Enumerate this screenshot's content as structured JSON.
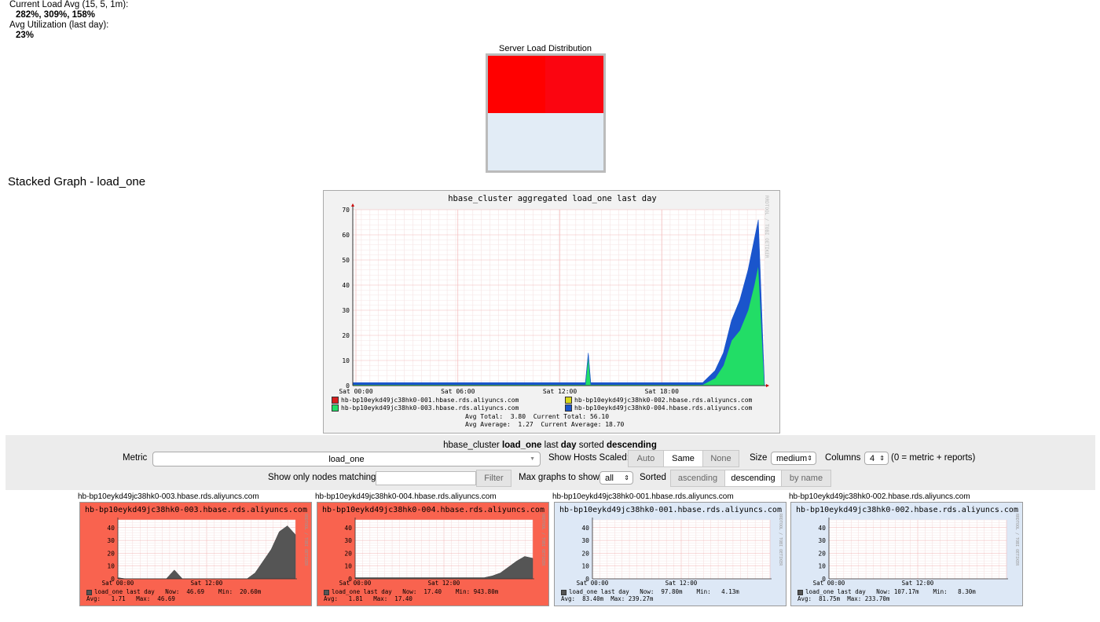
{
  "summary": {
    "load_avg_label": "Current Load Avg (15, 5, 1m):",
    "load_avg_value": "282%, 309%, 158%",
    "util_label": "Avg Utilization (last day):",
    "util_value": "23%"
  },
  "heatmap": {
    "title": "Server Load Distribution",
    "cells": [
      {
        "color": "#ff0000"
      },
      {
        "color": "#fb0510"
      },
      {
        "color": "#e2ecf6"
      },
      {
        "color": "#e2ecf6"
      }
    ]
  },
  "stacked": {
    "section_title": "Stacked Graph - load_one",
    "graph_title": "hbase_cluster aggregated load_one last day",
    "side_label": "RRDTOOL / TOBI OETIKER",
    "legend": [
      {
        "name": "hb-bp10eykd49jc38hk0-001.hbase.rds.aliyuncs.com",
        "color": "#d81e1e"
      },
      {
        "name": "hb-bp10eykd49jc38hk0-002.hbase.rds.aliyuncs.com",
        "color": "#d9d91a"
      },
      {
        "name": "hb-bp10eykd49jc38hk0-003.hbase.rds.aliyuncs.com",
        "color": "#22dd66"
      },
      {
        "name": "hb-bp10eykd49jc38hk0-004.hbase.rds.aliyuncs.com",
        "color": "#1a55cc"
      }
    ],
    "stats_line1": "Avg Total:  3.80  Current Total: 56.10",
    "stats_line2": "Avg Average:  1.27  Current Average: 18.70"
  },
  "chart_data": {
    "type": "area",
    "title": "hbase_cluster aggregated load_one last day",
    "ylim": [
      0,
      70
    ],
    "yticks": [
      "0",
      "10",
      "20",
      "30",
      "40",
      "50",
      "60",
      "70"
    ],
    "xticks": [
      "Sat 00:00",
      "Sat 06:00",
      "Sat 12:00",
      "Sat 18:00"
    ],
    "x": [
      0,
      0.3,
      0.565,
      0.572,
      0.578,
      0.85,
      0.88,
      0.9,
      0.92,
      0.94,
      0.96,
      0.975,
      0.985,
      1.0
    ],
    "series": [
      {
        "name": "hb-bp10eykd49jc38hk0-003.hbase.rds.aliyuncs.com",
        "color": "#22dd66",
        "values": [
          0.4,
          0.4,
          0.4,
          12,
          0.4,
          0.4,
          3,
          8,
          18,
          22,
          30,
          40,
          48,
          0
        ]
      },
      {
        "name": "hb-bp10eykd49jc38hk0-004.hbase.rds.aliyuncs.com",
        "color": "#1a55cc",
        "values": [
          0.8,
          0.8,
          0.8,
          1,
          0.8,
          0.8,
          3,
          5,
          8,
          12,
          16,
          18,
          18,
          0
        ]
      }
    ]
  },
  "controls": {
    "heading_prefix": "hbase_cluster",
    "heading_metric": "load_one",
    "heading_mid": "last",
    "heading_range": "day",
    "heading_sorted": "sorted",
    "heading_order": "descending",
    "metric_label": "Metric",
    "metric_value": "load_one",
    "scaled_label": "Show Hosts Scaled:",
    "scaled_options": [
      "Auto",
      "Same",
      "None"
    ],
    "scaled_selected": "Same",
    "size_label": "Size",
    "size_value": "medium",
    "columns_label": "Columns",
    "columns_value": "4",
    "columns_note": "(0 = metric + reports)",
    "filter_label": "Show only nodes matching",
    "filter_value": "",
    "filter_button": "Filter",
    "max_label": "Max graphs to show",
    "max_value": "all",
    "sorted_label": "Sorted",
    "sort_options": [
      "ascending",
      "descending",
      "by name"
    ],
    "sort_selected": "descending"
  },
  "hosts": [
    {
      "name": "hb-bp10eykd49jc38hk0-003.hbase.rds.aliyuncs.com",
      "state": "hot",
      "legend1": "load_one last day   Now:  46.69    Min:  20.60m",
      "legend2": "Avg:   1.71   Max:  46.69",
      "spike": [
        0.02,
        0,
        0,
        0,
        0,
        0,
        0,
        0.15,
        0,
        0,
        0,
        0,
        0,
        0,
        0,
        0,
        0,
        0.1,
        0.3,
        0.5,
        0.8,
        0.9,
        0.75
      ]
    },
    {
      "name": "hb-bp10eykd49jc38hk0-004.hbase.rds.aliyuncs.com",
      "state": "hot",
      "legend1": "load_one last day   Now:  17.40    Min: 943.80m",
      "legend2": "Avg:   1.81   Max:  17.40",
      "spike": [
        0.02,
        0.02,
        0.02,
        0.02,
        0.02,
        0.02,
        0.02,
        0.02,
        0.02,
        0.02,
        0.02,
        0.02,
        0.02,
        0.02,
        0.02,
        0.02,
        0.02,
        0.05,
        0.1,
        0.2,
        0.3,
        0.38,
        0.35
      ]
    },
    {
      "name": "hb-bp10eykd49jc38hk0-001.hbase.rds.aliyuncs.com",
      "state": "cool",
      "legend1": "load_one last day   Now:  97.80m    Min:   4.13m",
      "legend2": "Avg:  83.40m  Max: 239.27m",
      "spike": []
    },
    {
      "name": "hb-bp10eykd49jc38hk0-002.hbase.rds.aliyuncs.com",
      "state": "cool",
      "legend1": "load_one last day   Now: 107.17m    Min:   8.30m",
      "legend2": "Avg:  81.75m  Max: 233.70m",
      "spike": []
    }
  ],
  "host_chart": {
    "yticks": [
      "0",
      "10",
      "20",
      "30",
      "40"
    ],
    "xticks": [
      "Sat 00:00",
      "Sat 12:00"
    ],
    "side_label": "RRDTOOL / TOBI OETIKER"
  }
}
